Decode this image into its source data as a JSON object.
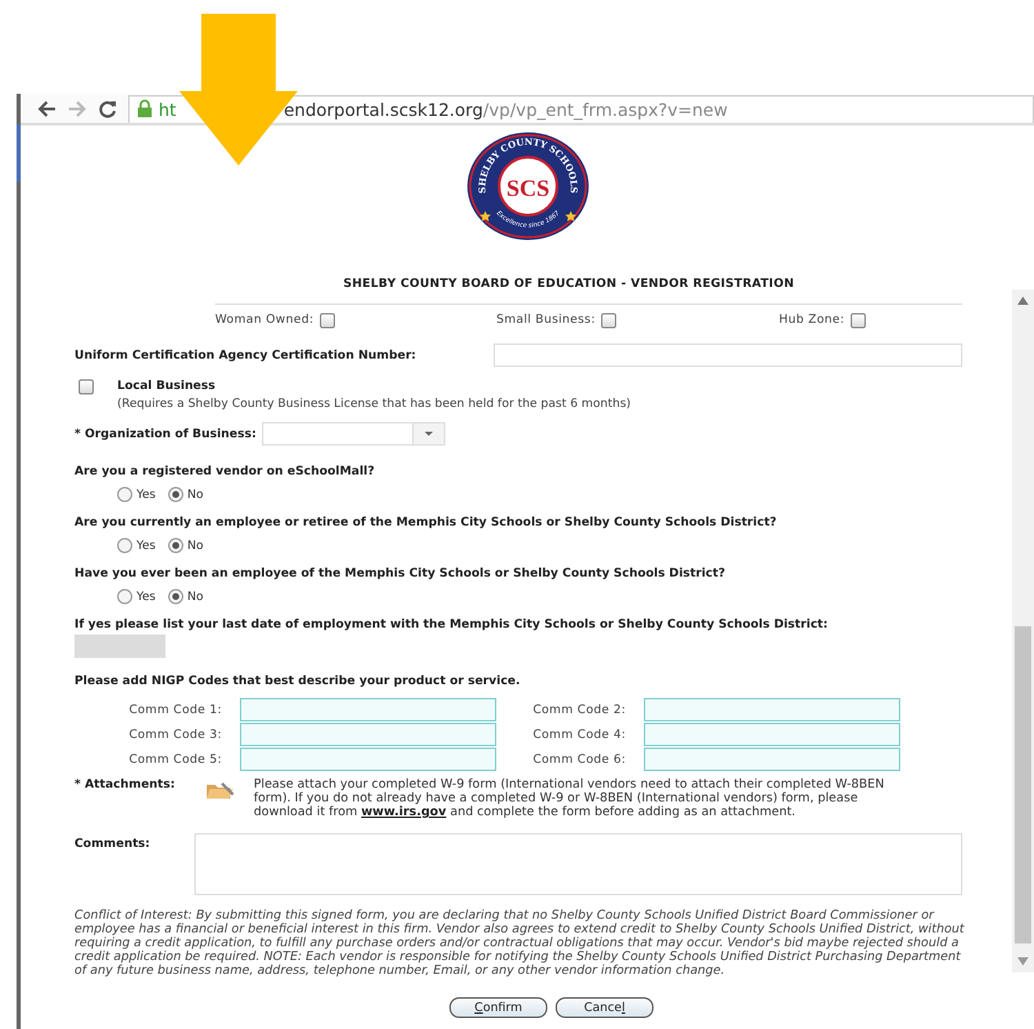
{
  "browser": {
    "url_scheme": "ht",
    "url_host": "endorportal.scsk12.org",
    "url_path": "/vp/vp_ent_frm.aspx?v=new"
  },
  "logo": {
    "ring_text": "SHELBY COUNTY SCHOOLS",
    "monogram": "SCS",
    "motto": "Excellence since 1867"
  },
  "title": "SHELBY COUNTY BOARD OF EDUCATION - VENDOR REGISTRATION",
  "business_flags": [
    {
      "label": "Woman Owned:",
      "checked": false
    },
    {
      "label": "Small Business:",
      "checked": false
    },
    {
      "label": "Hub Zone:",
      "checked": false
    }
  ],
  "certification": {
    "label": "Uniform Certification Agency Certification Number:"
  },
  "local_business": {
    "label": "Local Business",
    "checked": false,
    "note": "(Requires a Shelby County Business License that has been held for the past 6 months)"
  },
  "organization": {
    "label": "* Organization of Business:"
  },
  "questions": [
    {
      "text": "Are you a registered vendor on eSchoolMall?",
      "options": [
        {
          "label": "Yes",
          "selected": false
        },
        {
          "label": "No",
          "selected": true
        }
      ]
    },
    {
      "text": "Are you currently an employee or retiree of the Memphis City Schools or Shelby County Schools District?",
      "options": [
        {
          "label": "Yes",
          "selected": false
        },
        {
          "label": "No",
          "selected": true
        }
      ]
    },
    {
      "text": "Have you ever been an employee of the Memphis City Schools or Shelby County Schools District?",
      "options": [
        {
          "label": "Yes",
          "selected": false
        },
        {
          "label": "No",
          "selected": true
        }
      ]
    }
  ],
  "employment_date": {
    "label": "If yes please list your last date of employment with the Memphis City Schools or Shelby County Schools District:",
    "disabled": true
  },
  "nigp": {
    "heading": "Please add NIGP Codes that best describe your product or service.",
    "codes": [
      {
        "label": "Comm Code 1:"
      },
      {
        "label": "Comm Code 2:"
      },
      {
        "label": "Comm Code 3:"
      },
      {
        "label": "Comm Code 4:"
      },
      {
        "label": "Comm Code 5:"
      },
      {
        "label": "Comm Code 6:"
      }
    ]
  },
  "attachments": {
    "label": "* Attachments:",
    "text_before": "Please attach your completed W-9 form (International vendors need to attach their completed W-8BEN form). If you do not already have a completed W-9 or W-8BEN (International vendors) form, please download it from ",
    "link": "www.irs.gov",
    "text_after": " and complete the form before adding as an attachment."
  },
  "comments": {
    "label": "Comments:"
  },
  "disclaimer": "Conflict of Interest: By submitting this signed form, you are declaring that no Shelby County Schools Unified District Board Commissioner or employee has a financial or beneficial interest in this firm. Vendor also agrees to extend credit to Shelby County Schools Unified District, without requiring a credit application, to fulfill any purchase orders and/or contractual obligations that may occur. Vendor's bid maybe rejected should a credit application be required. NOTE: Each vendor is responsible for notifying the Shelby County Schools Unified District Purchasing Department of any future business name, address, telephone number, Email, or any other vendor information change.",
  "buttons": [
    {
      "access_key": "C",
      "label_end": "onfirm"
    },
    {
      "label_start": "Cance",
      "access_key": "l"
    }
  ]
}
